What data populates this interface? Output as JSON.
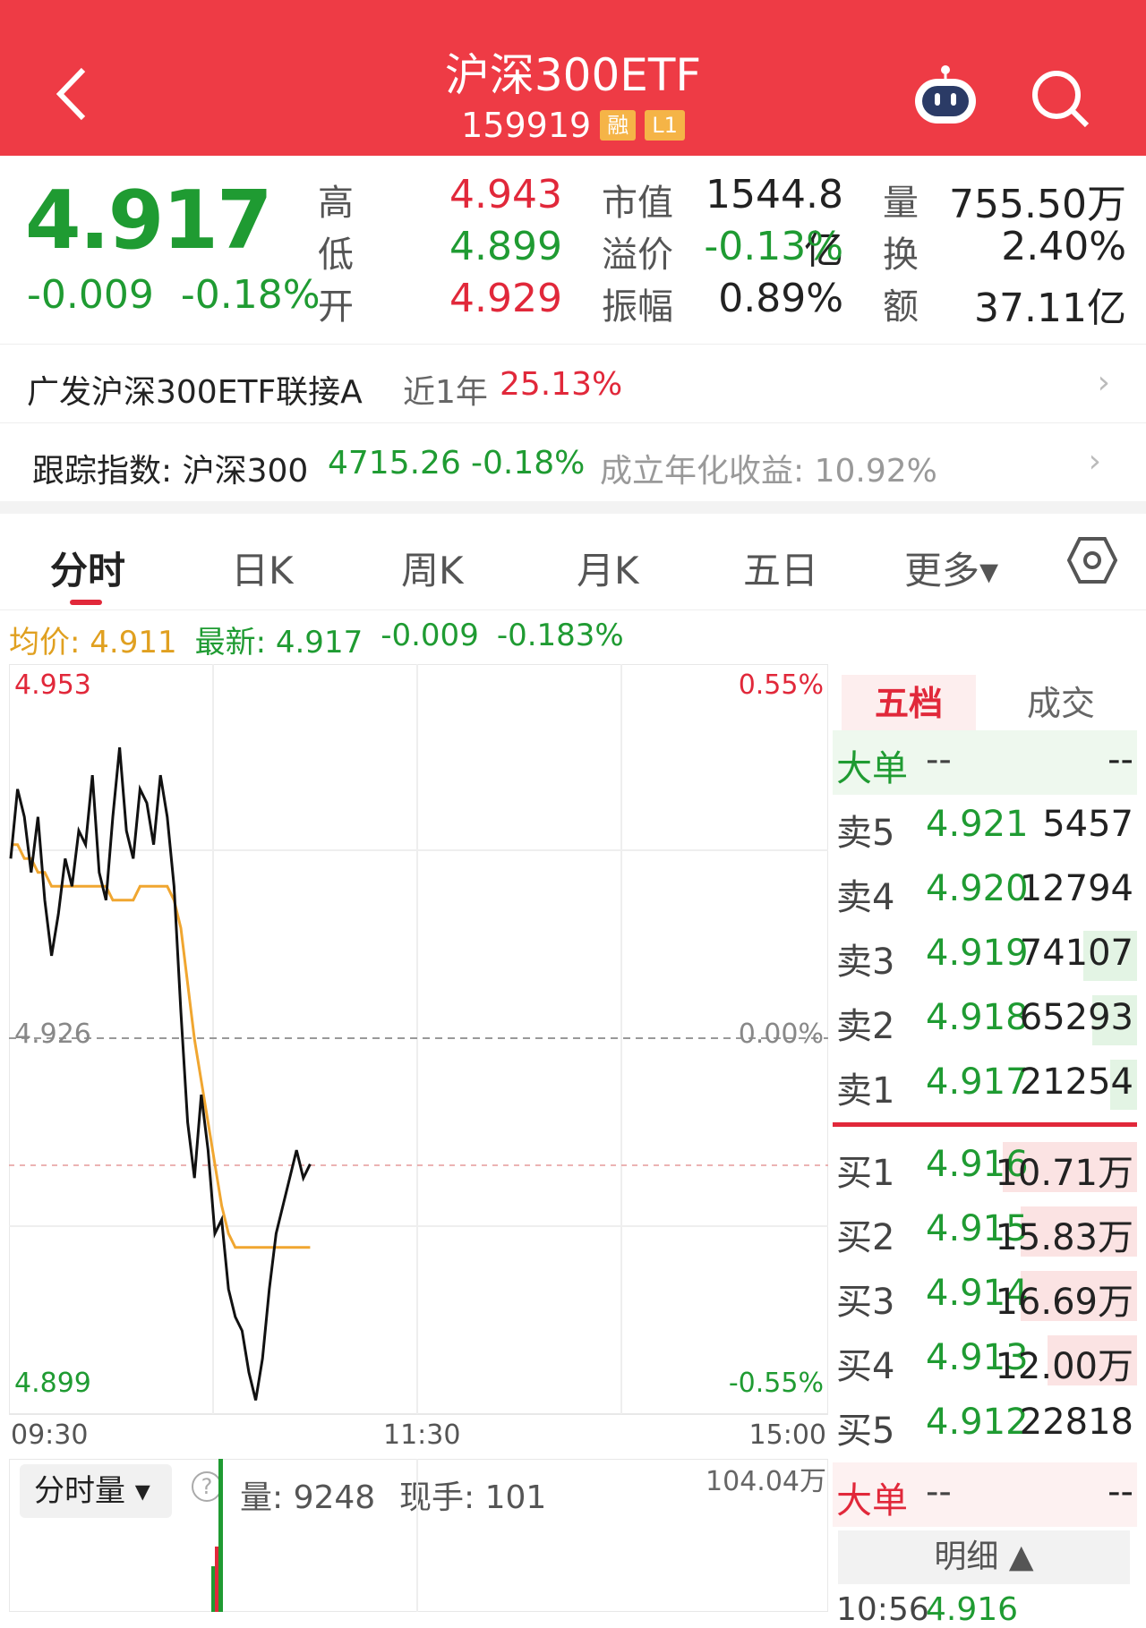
{
  "header": {
    "title": "沪深300ETF",
    "code": "159919",
    "badge_margin": "融",
    "badge_level": "L1"
  },
  "quote": {
    "last": "4.917",
    "change": "-0.009",
    "change_pct": "-0.18%",
    "high_label": "高",
    "high": "4.943",
    "low_label": "低",
    "low": "4.899",
    "open_label": "开",
    "open": "4.929",
    "mcap_label": "市值",
    "mcap": "1544.8亿",
    "premium_label": "溢价",
    "premium": "-0.13%",
    "amp_label": "振幅",
    "amp": "0.89%",
    "vol_label": "量",
    "vol": "755.50万",
    "turn_label": "换",
    "turn": "2.40%",
    "amt_label": "额",
    "amt": "37.11亿"
  },
  "fund": {
    "name": "广发沪深300ETF联接A",
    "period": "近1年",
    "ret": "25.13%"
  },
  "index": {
    "label": "跟踪指数: 沪深300",
    "value": "4715.26",
    "pct": "-0.18%",
    "annual": "成立年化收益: 10.92%"
  },
  "tabs": [
    "分时",
    "日K",
    "周K",
    "月K",
    "五日",
    "更多▾"
  ],
  "info": {
    "avg": "均价: 4.911",
    "latest": "最新: 4.917",
    "chg": "-0.009",
    "pct": "-0.183%"
  },
  "axis": {
    "y_top": "4.953",
    "y_mid": "4.926",
    "y_bot": "4.899",
    "p_top": "0.55%",
    "p_mid": "0.00%",
    "p_bot": "-0.55%",
    "t0": "09:30",
    "t1": "11:30",
    "t2": "15:00"
  },
  "orderbook": {
    "tab1": "五档",
    "tab2": "成交",
    "big": "大单",
    "dash": "--",
    "asks": [
      {
        "l": "卖5",
        "p": "4.921",
        "v": "5457"
      },
      {
        "l": "卖4",
        "p": "4.920",
        "v": "12794"
      },
      {
        "l": "卖3",
        "p": "4.919",
        "v": "74107"
      },
      {
        "l": "卖2",
        "p": "4.918",
        "v": "65293"
      },
      {
        "l": "卖1",
        "p": "4.917",
        "v": "21254"
      }
    ],
    "bids": [
      {
        "l": "买1",
        "p": "4.916",
        "v": "10.71万"
      },
      {
        "l": "买2",
        "p": "4.915",
        "v": "15.83万"
      },
      {
        "l": "买3",
        "p": "4.914",
        "v": "16.69万"
      },
      {
        "l": "买4",
        "p": "4.913",
        "v": "12.00万"
      },
      {
        "l": "买5",
        "p": "4.912",
        "v": "22818"
      }
    ],
    "detail": "明细 ▲",
    "trade_time": "10:56",
    "trade_price": "4.916"
  },
  "volume": {
    "select": "分时量 ▾",
    "vol": "量: 9248",
    "hand": "现手: 101",
    "max": "104.04万"
  },
  "chart_data": {
    "type": "line",
    "ylim": [
      4.899,
      4.953
    ],
    "prev_close": 4.926,
    "series": [
      {
        "name": "最新",
        "values": [
          4.939,
          4.944,
          4.942,
          4.938,
          4.942,
          4.936,
          4.932,
          4.935,
          4.939,
          4.937,
          4.941,
          4.94,
          4.945,
          4.938,
          4.936,
          4.942,
          4.947,
          4.941,
          4.939,
          4.944,
          4.943,
          4.94,
          4.945,
          4.942,
          4.937,
          4.928,
          4.92,
          4.916,
          4.922,
          4.918,
          4.912,
          4.913,
          4.908,
          4.906,
          4.905,
          4.902,
          4.9,
          4.903,
          4.908,
          4.912,
          4.914,
          4.916,
          4.918,
          4.916,
          4.917
        ]
      },
      {
        "name": "均价",
        "values": [
          4.94,
          4.94,
          4.939,
          4.939,
          4.938,
          4.938,
          4.937,
          4.937,
          4.937,
          4.937,
          4.937,
          4.937,
          4.937,
          4.937,
          4.937,
          4.936,
          4.936,
          4.936,
          4.936,
          4.937,
          4.937,
          4.937,
          4.937,
          4.937,
          4.936,
          4.934,
          4.93,
          4.926,
          4.923,
          4.92,
          4.917,
          4.914,
          4.912,
          4.911,
          4.911,
          4.911,
          4.911,
          4.911,
          4.911,
          4.911,
          4.911,
          4.911,
          4.911,
          4.911,
          4.911
        ]
      }
    ]
  }
}
